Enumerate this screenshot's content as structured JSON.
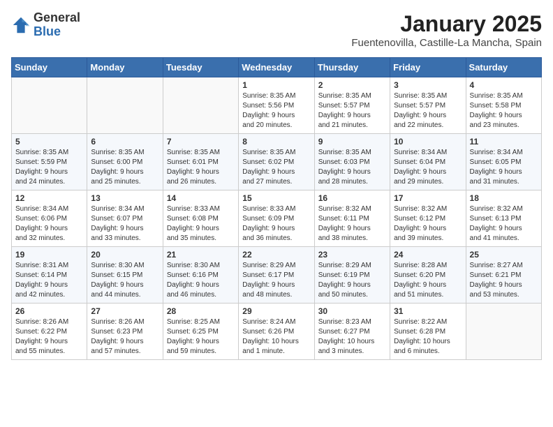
{
  "header": {
    "logo_general": "General",
    "logo_blue": "Blue",
    "month": "January 2025",
    "location": "Fuentenovilla, Castille-La Mancha, Spain"
  },
  "weekdays": [
    "Sunday",
    "Monday",
    "Tuesday",
    "Wednesday",
    "Thursday",
    "Friday",
    "Saturday"
  ],
  "weeks": [
    [
      {
        "day": "",
        "info": ""
      },
      {
        "day": "",
        "info": ""
      },
      {
        "day": "",
        "info": ""
      },
      {
        "day": "1",
        "info": "Sunrise: 8:35 AM\nSunset: 5:56 PM\nDaylight: 9 hours\nand 20 minutes."
      },
      {
        "day": "2",
        "info": "Sunrise: 8:35 AM\nSunset: 5:57 PM\nDaylight: 9 hours\nand 21 minutes."
      },
      {
        "day": "3",
        "info": "Sunrise: 8:35 AM\nSunset: 5:57 PM\nDaylight: 9 hours\nand 22 minutes."
      },
      {
        "day": "4",
        "info": "Sunrise: 8:35 AM\nSunset: 5:58 PM\nDaylight: 9 hours\nand 23 minutes."
      }
    ],
    [
      {
        "day": "5",
        "info": "Sunrise: 8:35 AM\nSunset: 5:59 PM\nDaylight: 9 hours\nand 24 minutes."
      },
      {
        "day": "6",
        "info": "Sunrise: 8:35 AM\nSunset: 6:00 PM\nDaylight: 9 hours\nand 25 minutes."
      },
      {
        "day": "7",
        "info": "Sunrise: 8:35 AM\nSunset: 6:01 PM\nDaylight: 9 hours\nand 26 minutes."
      },
      {
        "day": "8",
        "info": "Sunrise: 8:35 AM\nSunset: 6:02 PM\nDaylight: 9 hours\nand 27 minutes."
      },
      {
        "day": "9",
        "info": "Sunrise: 8:35 AM\nSunset: 6:03 PM\nDaylight: 9 hours\nand 28 minutes."
      },
      {
        "day": "10",
        "info": "Sunrise: 8:34 AM\nSunset: 6:04 PM\nDaylight: 9 hours\nand 29 minutes."
      },
      {
        "day": "11",
        "info": "Sunrise: 8:34 AM\nSunset: 6:05 PM\nDaylight: 9 hours\nand 31 minutes."
      }
    ],
    [
      {
        "day": "12",
        "info": "Sunrise: 8:34 AM\nSunset: 6:06 PM\nDaylight: 9 hours\nand 32 minutes."
      },
      {
        "day": "13",
        "info": "Sunrise: 8:34 AM\nSunset: 6:07 PM\nDaylight: 9 hours\nand 33 minutes."
      },
      {
        "day": "14",
        "info": "Sunrise: 8:33 AM\nSunset: 6:08 PM\nDaylight: 9 hours\nand 35 minutes."
      },
      {
        "day": "15",
        "info": "Sunrise: 8:33 AM\nSunset: 6:09 PM\nDaylight: 9 hours\nand 36 minutes."
      },
      {
        "day": "16",
        "info": "Sunrise: 8:32 AM\nSunset: 6:11 PM\nDaylight: 9 hours\nand 38 minutes."
      },
      {
        "day": "17",
        "info": "Sunrise: 8:32 AM\nSunset: 6:12 PM\nDaylight: 9 hours\nand 39 minutes."
      },
      {
        "day": "18",
        "info": "Sunrise: 8:32 AM\nSunset: 6:13 PM\nDaylight: 9 hours\nand 41 minutes."
      }
    ],
    [
      {
        "day": "19",
        "info": "Sunrise: 8:31 AM\nSunset: 6:14 PM\nDaylight: 9 hours\nand 42 minutes."
      },
      {
        "day": "20",
        "info": "Sunrise: 8:30 AM\nSunset: 6:15 PM\nDaylight: 9 hours\nand 44 minutes."
      },
      {
        "day": "21",
        "info": "Sunrise: 8:30 AM\nSunset: 6:16 PM\nDaylight: 9 hours\nand 46 minutes."
      },
      {
        "day": "22",
        "info": "Sunrise: 8:29 AM\nSunset: 6:17 PM\nDaylight: 9 hours\nand 48 minutes."
      },
      {
        "day": "23",
        "info": "Sunrise: 8:29 AM\nSunset: 6:19 PM\nDaylight: 9 hours\nand 50 minutes."
      },
      {
        "day": "24",
        "info": "Sunrise: 8:28 AM\nSunset: 6:20 PM\nDaylight: 9 hours\nand 51 minutes."
      },
      {
        "day": "25",
        "info": "Sunrise: 8:27 AM\nSunset: 6:21 PM\nDaylight: 9 hours\nand 53 minutes."
      }
    ],
    [
      {
        "day": "26",
        "info": "Sunrise: 8:26 AM\nSunset: 6:22 PM\nDaylight: 9 hours\nand 55 minutes."
      },
      {
        "day": "27",
        "info": "Sunrise: 8:26 AM\nSunset: 6:23 PM\nDaylight: 9 hours\nand 57 minutes."
      },
      {
        "day": "28",
        "info": "Sunrise: 8:25 AM\nSunset: 6:25 PM\nDaylight: 9 hours\nand 59 minutes."
      },
      {
        "day": "29",
        "info": "Sunrise: 8:24 AM\nSunset: 6:26 PM\nDaylight: 10 hours\nand 1 minute."
      },
      {
        "day": "30",
        "info": "Sunrise: 8:23 AM\nSunset: 6:27 PM\nDaylight: 10 hours\nand 3 minutes."
      },
      {
        "day": "31",
        "info": "Sunrise: 8:22 AM\nSunset: 6:28 PM\nDaylight: 10 hours\nand 6 minutes."
      },
      {
        "day": "",
        "info": ""
      }
    ]
  ]
}
